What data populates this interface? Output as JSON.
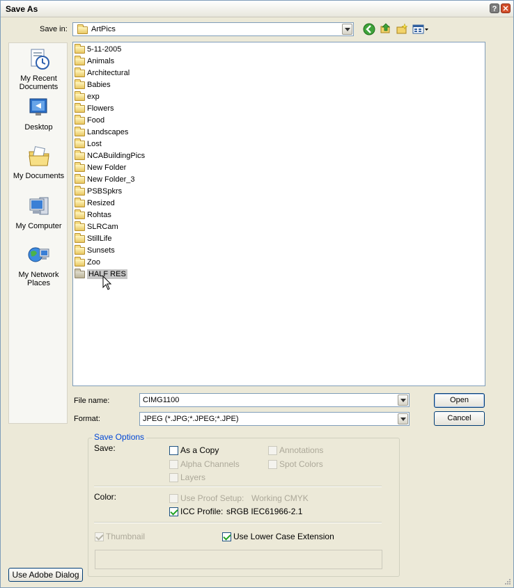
{
  "window": {
    "title": "Save As",
    "help_glyph": "?",
    "close_glyph": "✕"
  },
  "save_in": {
    "label": "Save in:",
    "value": "ArtPics",
    "icons": [
      "back-icon",
      "up-one-level-icon",
      "new-folder-icon",
      "views-menu-icon"
    ]
  },
  "places": [
    {
      "label": "My Recent Documents",
      "icon": "recent-documents-icon"
    },
    {
      "label": "Desktop",
      "icon": "desktop-icon"
    },
    {
      "label": "My Documents",
      "icon": "my-documents-icon"
    },
    {
      "label": "My Computer",
      "icon": "my-computer-icon"
    },
    {
      "label": "My Network Places",
      "icon": "network-places-icon"
    }
  ],
  "files": [
    "5-11-2005",
    "Animals",
    "Architectural",
    "Babies",
    "exp",
    "Flowers",
    "Food",
    "Landscapes",
    "Lost",
    "NCABuildingPics",
    "New Folder",
    "New Folder_3",
    "PSBSpkrs",
    "Resized",
    "Rohtas",
    "SLRCam",
    "StillLife",
    "Sunsets",
    "Zoo",
    "HALF RES"
  ],
  "selected_file_index": 19,
  "file_name": {
    "label": "File name:",
    "value": "CIMG1100"
  },
  "format": {
    "label": "Format:",
    "value": "JPEG (*.JPG;*.JPEG;*.JPE)"
  },
  "buttons": {
    "open": "Open",
    "cancel": "Cancel",
    "use_adobe": "Use Adobe Dialog"
  },
  "save_options": {
    "title": "Save Options",
    "save_label": "Save:",
    "as_a_copy": {
      "label": "As a Copy",
      "checked": false,
      "enabled": true
    },
    "annotations": {
      "label": "Annotations",
      "checked": false,
      "enabled": false
    },
    "alpha_channels": {
      "label": "Alpha Channels",
      "checked": false,
      "enabled": false
    },
    "spot_colors": {
      "label": "Spot Colors",
      "checked": false,
      "enabled": false
    },
    "layers": {
      "label": "Layers",
      "checked": false,
      "enabled": false
    },
    "color_label": "Color:",
    "use_proof_setup": {
      "label": "Use Proof Setup:",
      "value": "Working CMYK",
      "checked": false,
      "enabled": false
    },
    "icc_profile": {
      "label": "ICC Profile:",
      "value": "sRGB IEC61966-2.1",
      "checked": true,
      "enabled": true
    },
    "thumbnail": {
      "label": "Thumbnail",
      "checked": true,
      "enabled": false
    },
    "lower_case_ext": {
      "label": "Use Lower Case Extension",
      "checked": true,
      "enabled": true
    }
  },
  "colors": {
    "dialog_bg": "#ece9d8",
    "border": "#7f9db9",
    "group_title": "#0046d5",
    "selection": "#c6c6c6"
  }
}
